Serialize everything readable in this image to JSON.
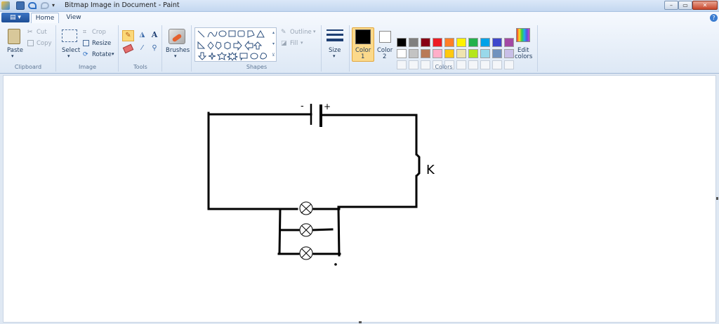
{
  "window": {
    "title": "Bitmap Image in Document - Paint"
  },
  "tabs": [
    {
      "label": "Home"
    },
    {
      "label": "View"
    }
  ],
  "clipboard": {
    "paste": "Paste",
    "cut": "Cut",
    "copy": "Copy",
    "group": "Clipboard"
  },
  "image": {
    "select": "Select",
    "crop": "Crop",
    "resize": "Resize",
    "rotate": "Rotate",
    "group": "Image"
  },
  "tools": {
    "group": "Tools"
  },
  "brushes": {
    "label": "Brushes"
  },
  "shapes": {
    "outline": "Outline",
    "fill": "Fill",
    "group": "Shapes"
  },
  "size": {
    "label": "Size"
  },
  "colors": {
    "color1": "Color",
    "color1_num": "1",
    "color2": "Color",
    "color2_num": "2",
    "edit": "Edit",
    "edit2": "colors",
    "group": "Colors",
    "row1": [
      "#000000",
      "#7f7f7f",
      "#880015",
      "#ed1c24",
      "#ff7f27",
      "#fff200",
      "#22b14c",
      "#00a2e8",
      "#3f48cc",
      "#a349a4"
    ],
    "row2": [
      "#ffffff",
      "#c3c3c3",
      "#b97a57",
      "#ffaec9",
      "#ffc90e",
      "#efe4b0",
      "#b5e61d",
      "#99d9ea",
      "#7092be",
      "#c8bfe7"
    ],
    "color1_value": "#000000",
    "color2_value": "#ffffff"
  },
  "drawing": {
    "battery_minus": "-",
    "battery_plus": "+",
    "switch_label": "K"
  }
}
